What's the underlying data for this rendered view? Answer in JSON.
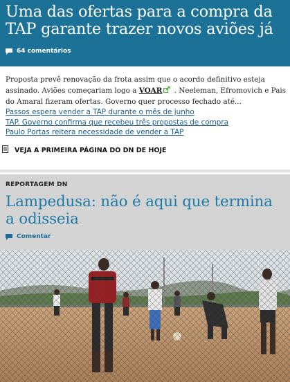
{
  "top_story": {
    "title": "Uma das ofertas para a compra da TAP garante trazer novos aviões já",
    "comments": "64 comentários"
  },
  "summary": {
    "text_before": "Proposta prevê renovação da frota assim que o acordo definitivo esteja assinado. Aviões começariam logo a ",
    "link": "VOAR",
    "text_after": " . Neeleman, Efromovich e Pais do Amaral fizeram ofertas. Governo quer processo fechado até..."
  },
  "related": [
    "Passos espera vender a TAP durante o mês de junho",
    "TAP. Governo confirma que recebeu três propostas de compra",
    "Paulo Portas reitera necessidade de vender a TAP"
  ],
  "front_page": "VEJA A PRIMEIRA PÁGINA DO DN DE HOJE",
  "feature": {
    "section": "REPORTAGEM DN",
    "title": "Lampedusa: não é aqui que termina a odisseia",
    "comment": "Comentar"
  },
  "icons": {
    "comments": "speech-bubble-icon",
    "external": "external-link-icon",
    "document": "document-icon"
  },
  "colors": {
    "top_story_bg": "#1c7196",
    "link": "#1a5a8c",
    "feature_bg": "#d4d4d4",
    "feature_title": "#1e7aa7",
    "external_icon": "#4caf3e"
  }
}
